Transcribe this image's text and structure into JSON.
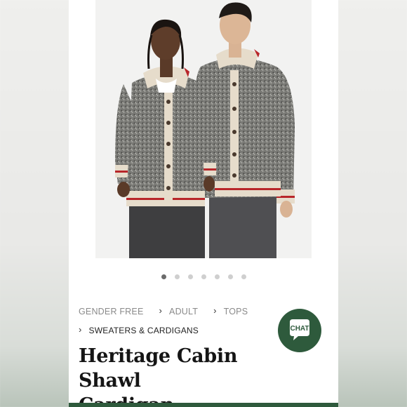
{
  "gallery": {
    "dot_count": 7,
    "active_index": 0
  },
  "breadcrumb": {
    "items": [
      "GENDER FREE",
      "ADULT",
      "TOPS"
    ],
    "current": "SWEATERS & CARDIGANS"
  },
  "product": {
    "title_line1": "Heritage Cabin Shawl",
    "title_line2": "Cardigan"
  },
  "chat_button": {
    "label": "CHAT"
  },
  "colors": {
    "brand_green": "#2e5a3c",
    "sweater_gray": "#6f6f6b",
    "cream": "#e8dfcf",
    "stripe_red": "#b8262a"
  }
}
